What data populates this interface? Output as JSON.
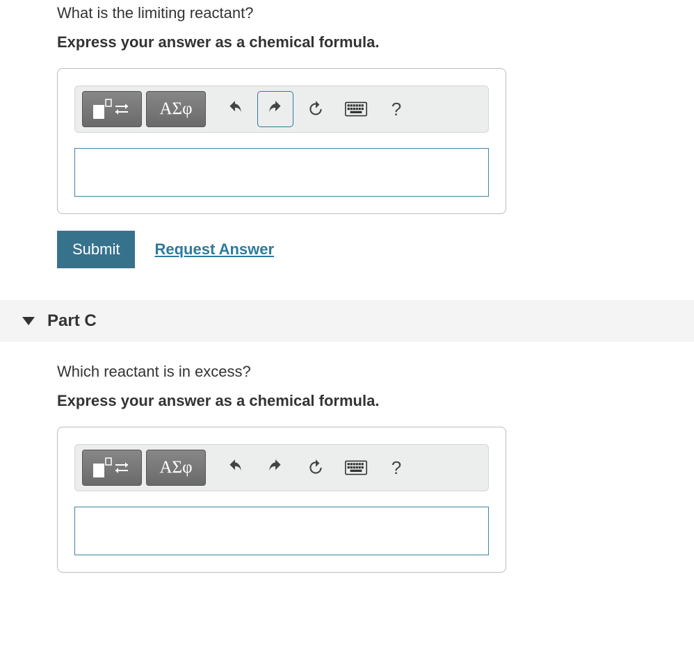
{
  "partB": {
    "question": "What is the limiting reactant?",
    "instruction": "Express your answer as a chemical formula.",
    "toolbar": {
      "greek_label": "ΑΣφ",
      "help_label": "?"
    },
    "input_value": "",
    "submit_label": "Submit",
    "request_label": "Request Answer"
  },
  "partC": {
    "header": "Part C",
    "question": "Which reactant is in excess?",
    "instruction": "Express your answer as a chemical formula.",
    "toolbar": {
      "greek_label": "ΑΣφ",
      "help_label": "?"
    },
    "input_value": ""
  }
}
